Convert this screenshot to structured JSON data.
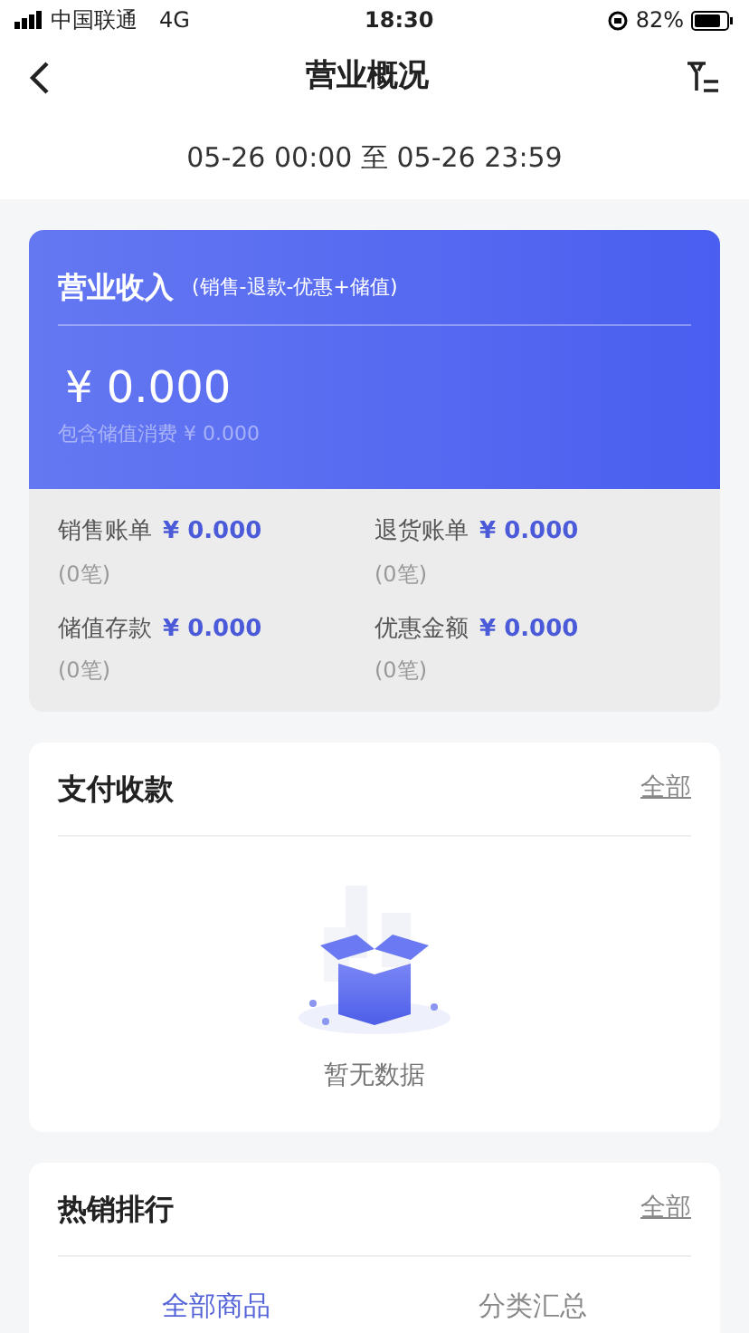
{
  "status_bar": {
    "carrier": "中国联通",
    "network": "4G",
    "time": "18:30",
    "battery": "82%"
  },
  "nav": {
    "title": "营业概况"
  },
  "date_range": "05-26 00:00 至 05-26 23:59",
  "revenue": {
    "title": "营业收入",
    "formula": "(销售-退款-优惠+储值)",
    "amount": "¥ 0.000",
    "note": "包含储值消费 ¥ 0.000",
    "stats": [
      {
        "label": "销售账单",
        "amount": "¥ 0.000",
        "count": "(0笔)"
      },
      {
        "label": "退货账单",
        "amount": "¥ 0.000",
        "count": "(0笔)"
      },
      {
        "label": "储值存款",
        "amount": "¥ 0.000",
        "count": "(0笔)"
      },
      {
        "label": "优惠金额",
        "amount": "¥ 0.000",
        "count": "(0笔)"
      }
    ]
  },
  "payments": {
    "title": "支付收款",
    "link": "全部",
    "empty_text": "暂无数据"
  },
  "hot_sales": {
    "title": "热销排行",
    "link": "全部",
    "tabs": [
      {
        "label": "全部商品",
        "selected": true
      },
      {
        "label": "分类汇总",
        "selected": false
      }
    ]
  }
}
